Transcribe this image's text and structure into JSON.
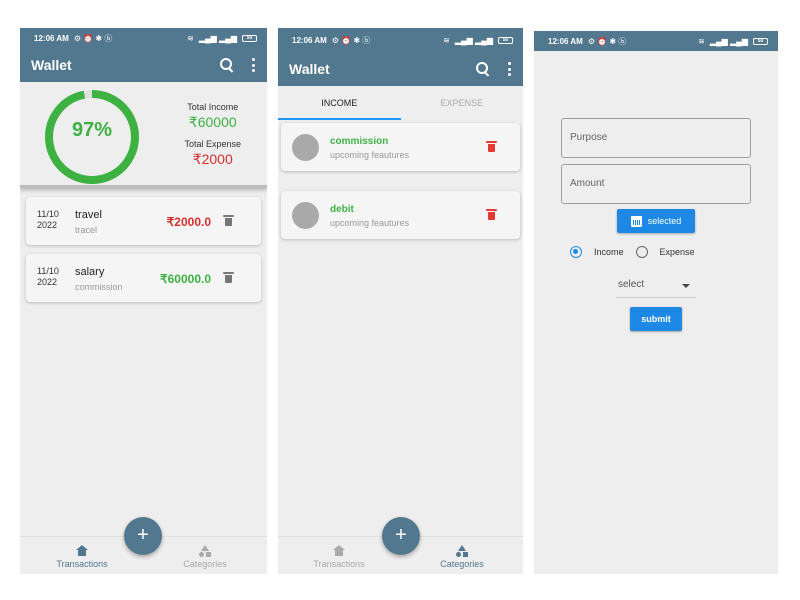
{
  "status": {
    "time": "12:06 AM",
    "battery": "50"
  },
  "colors": {
    "primary": "#52788f",
    "income": "#3db243",
    "expense": "#d32f2f",
    "accent": "#1e88e5"
  },
  "screen1": {
    "title": "Wallet",
    "summary": {
      "percent_label": "97%",
      "percent_value": 0.97,
      "total_income_label": "Total Income",
      "total_income": "₹60000",
      "total_expense_label": "Total Expense",
      "total_expense": "₹2000"
    },
    "transactions": [
      {
        "date_line1": "11/10",
        "date_line2": "2022",
        "name": "travel",
        "category": "tracel",
        "amount": "₹2000.0",
        "type": "expense"
      },
      {
        "date_line1": "11/10",
        "date_line2": "2022",
        "name": "salary",
        "category": "commission",
        "amount": "₹60000.0",
        "type": "income"
      }
    ],
    "nav": {
      "transactions": "Transactions",
      "categories": "Categories",
      "fab": "+"
    }
  },
  "screen2": {
    "title": "Wallet",
    "tabs": {
      "income": "INCOME",
      "expense": "EXPENSE"
    },
    "categories": [
      {
        "name": "commission",
        "subtitle": "upcoming feautures"
      },
      {
        "name": "debit",
        "subtitle": "upcoming feautures"
      }
    ],
    "nav": {
      "transactions": "Transactions",
      "categories": "Categories",
      "fab": "+"
    }
  },
  "screen3": {
    "purpose_placeholder": "Purpose",
    "amount_placeholder": "Amount",
    "date_button": "selected",
    "radio_income": "Income",
    "radio_expense": "Expense",
    "selected_type": "Income",
    "select_value": "select",
    "submit": "submit"
  }
}
